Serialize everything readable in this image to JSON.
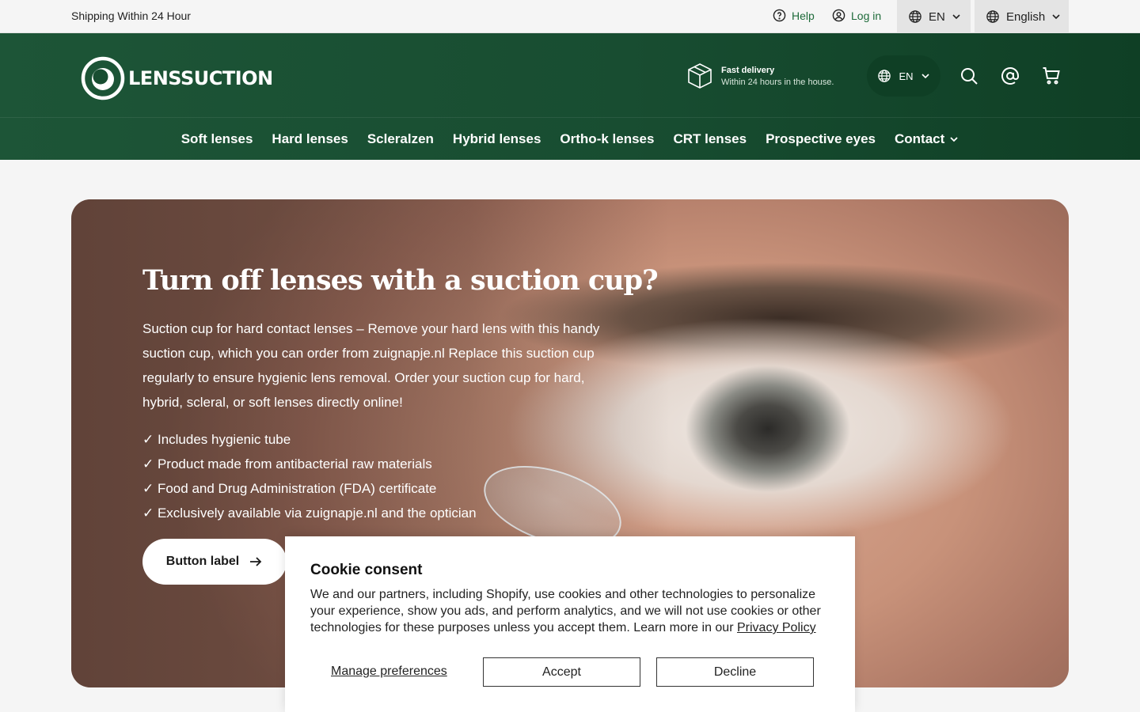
{
  "topbar": {
    "shipping": "Shipping Within 24 Hour",
    "help": "Help",
    "login": "Log in",
    "lang_code": "EN",
    "language": "English"
  },
  "header": {
    "logo_text": "LENSSUCTION",
    "fast_delivery_title": "Fast delivery",
    "fast_delivery_sub": "Within 24 hours in the house.",
    "lang_code": "EN",
    "icons": [
      "globe-icon",
      "search-icon",
      "at-icon",
      "cart-icon"
    ]
  },
  "nav": {
    "items": [
      {
        "label": "Soft lenses"
      },
      {
        "label": "Hard lenses"
      },
      {
        "label": "Scleralzen"
      },
      {
        "label": "Hybrid lenses"
      },
      {
        "label": "Ortho-k lenses"
      },
      {
        "label": "CRT lenses"
      },
      {
        "label": "Prospective eyes"
      },
      {
        "label": "Contact"
      }
    ]
  },
  "hero": {
    "title": "Turn off lenses with a suction cup?",
    "description": "Suction cup for hard contact lenses – Remove your hard lens with this handy suction cup, which you can order from zuignapje.nl Replace this suction cup regularly to ensure hygienic lens removal. Order your suction cup for hard, hybrid, scleral, or soft lenses directly online!",
    "checks": [
      "✓ Includes hygienic tube",
      "✓ Product made from antibacterial raw materials",
      "✓ Food and Drug Administration (FDA) certificate",
      "✓ Exclusively available via zuignapje.nl and the optician"
    ],
    "button_label": "Button label"
  },
  "cookie": {
    "title": "Cookie consent",
    "message": "We and our partners, including Shopify, use cookies and other technologies to personalize your experience, show you ads, and perform analytics, and we will not use cookies or other technologies for these purposes unless you accept them. Learn more in our ",
    "privacy_link": "Privacy Policy",
    "manage": "Manage preferences",
    "accept": "Accept",
    "decline": "Decline"
  },
  "colors": {
    "header_green": "#184d31",
    "link_green": "#1e6b3a"
  }
}
